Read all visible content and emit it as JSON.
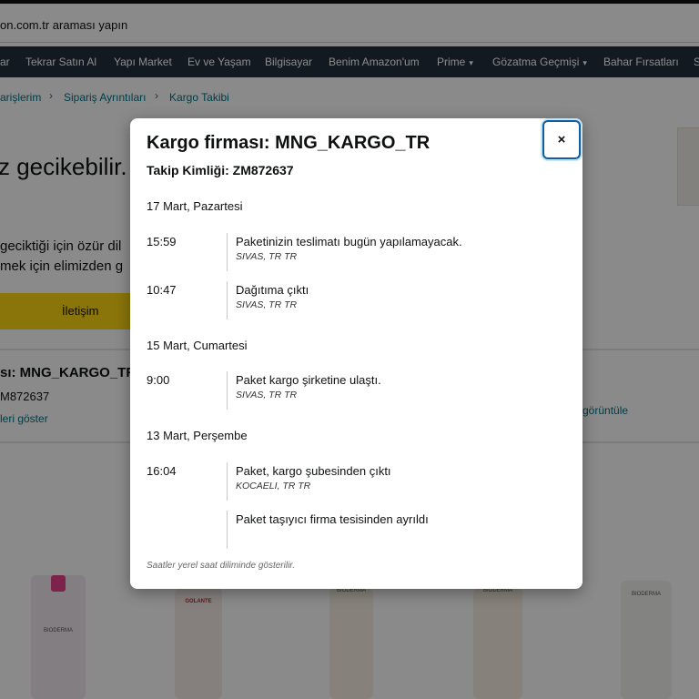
{
  "search": {
    "text": "on.com.tr araması yapın"
  },
  "nav": {
    "items": [
      {
        "label": "ar"
      },
      {
        "label": "Tekrar Satın Al"
      },
      {
        "label": "Yapı Market"
      },
      {
        "label": "Ev ve Yaşam"
      },
      {
        "label": "Bilgisayar"
      },
      {
        "label": "Benim Amazon'um"
      },
      {
        "label": "Prime"
      },
      {
        "label": "Gözatma Geçmişi"
      },
      {
        "label": "Bahar Fırsatları"
      },
      {
        "label": "S"
      }
    ],
    "dropdown_caret": "▾"
  },
  "breadcrumb": {
    "items": [
      {
        "label": "arişlerim"
      },
      {
        "label": "Sipariş Ayrıntıları"
      },
      {
        "label": "Kargo Takibi"
      }
    ],
    "separator": "›"
  },
  "background": {
    "delay_title": "z gecikebilir.",
    "apology_line1": "geciktiği için özür dil",
    "apology_line2": "mek için elimizden g",
    "contact_button": "İletişim",
    "carrier_partial": "sı: MNG_KARGO_TR",
    "tracking_partial": "M872637",
    "details_link": "leri göster",
    "view_link": "görüntüle",
    "products": [
      {
        "label": "BIODERMA"
      },
      {
        "label": "GOLANTE"
      },
      {
        "label": "BIODERMA"
      },
      {
        "label": "BIODERMA"
      },
      {
        "label": "BIODERMA"
      }
    ]
  },
  "modal": {
    "title": "Kargo firması: MNG_KARGO_TR",
    "tracking_id": "Takip Kimliği: ZM872637",
    "close_icon": "×",
    "days": [
      {
        "date": "17 Mart, Pazartesi",
        "events": [
          {
            "time": "15:59",
            "description": "Paketinizin teslimatı bugün yapılamayacak.",
            "location": "SIVAS, TR TR"
          },
          {
            "time": "10:47",
            "description": "Dağıtıma çıktı",
            "location": "SIVAS, TR TR"
          }
        ]
      },
      {
        "date": "15 Mart, Cumartesi",
        "events": [
          {
            "time": "9:00",
            "description": "Paket kargo şirketine ulaştı.",
            "location": "SIVAS, TR TR"
          }
        ]
      },
      {
        "date": "13 Mart, Perşembe",
        "events": [
          {
            "time": "16:04",
            "description": "Paket, kargo şubesinden çıktı",
            "location": "KOCAELI, TR TR"
          },
          {
            "time": "",
            "description": "Paket taşıyıcı firma tesisinden ayrıldı",
            "location": ""
          }
        ]
      }
    ],
    "footnote": "Saatler yerel saat diliminde gösterilir."
  }
}
